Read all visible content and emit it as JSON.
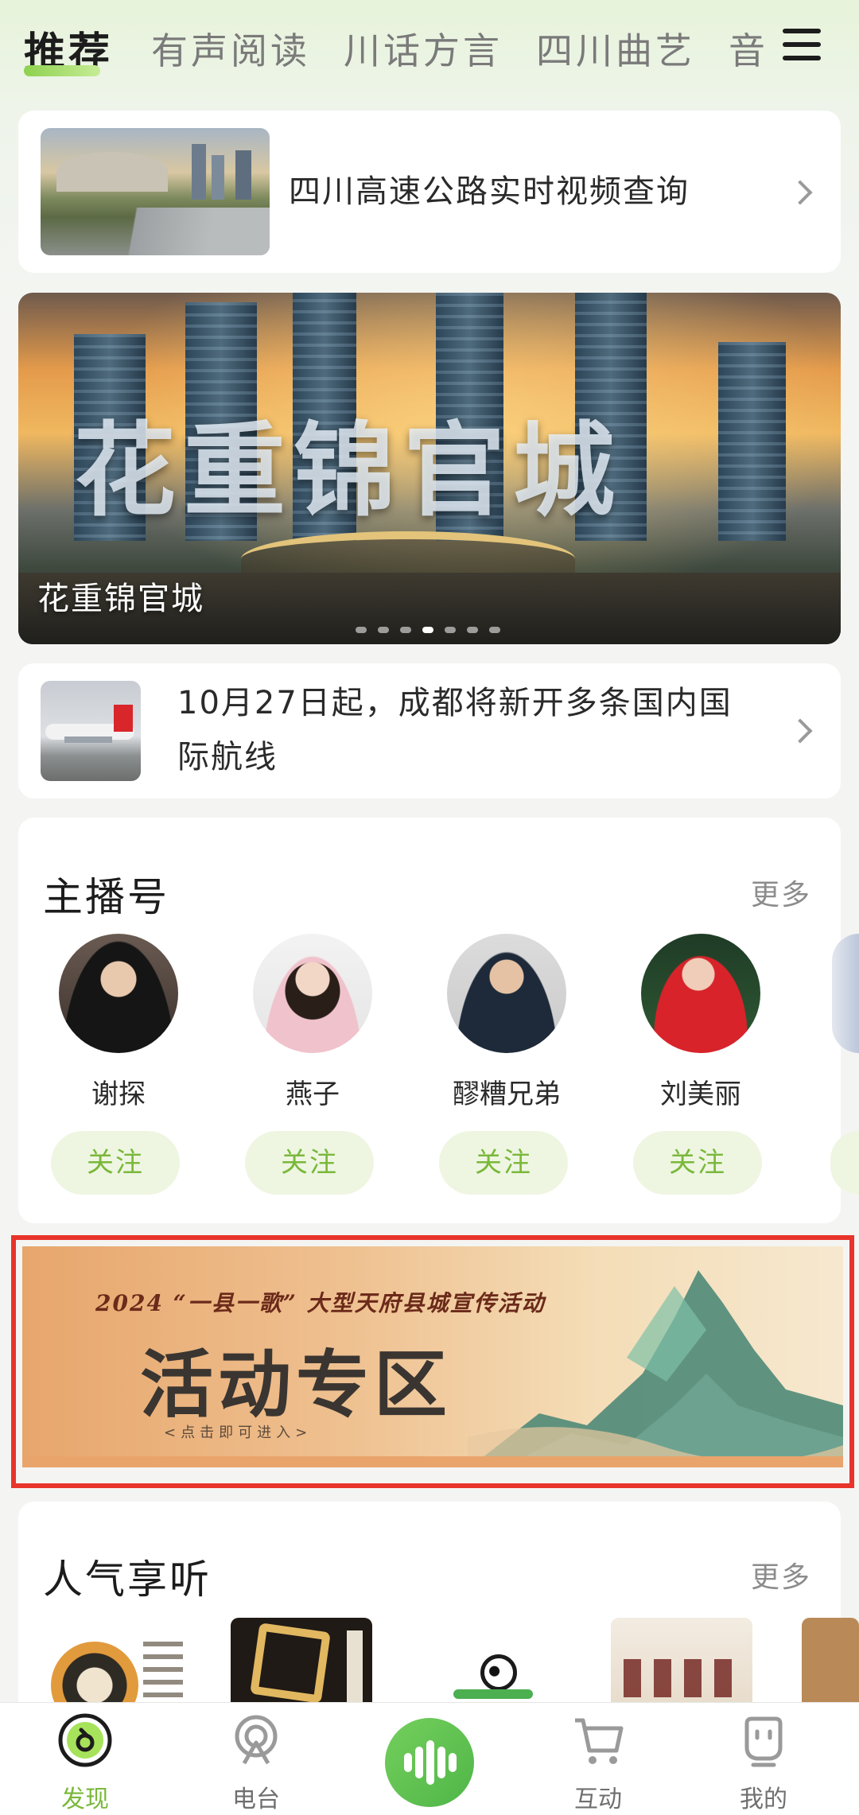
{
  "top_tabs": [
    "推荐",
    "有声阅读",
    "川话方言",
    "四川曲艺",
    "音"
  ],
  "news": [
    {
      "title": "四川高速公路实时视频查询"
    },
    {
      "title_line1": "10月27日起，成都将新开多条国内国",
      "title_line2": "际航线"
    }
  ],
  "banner": {
    "big_text": "花重锦官城",
    "caption": "花重锦官城"
  },
  "anchors_section": {
    "title": "主播号",
    "more": "更多",
    "anchors": [
      {
        "name": "谢探",
        "follow": "关注"
      },
      {
        "name": "燕子",
        "follow": "关注"
      },
      {
        "name": "醪糟兄弟",
        "follow": "关注"
      },
      {
        "name": "刘美丽",
        "follow": "关注"
      }
    ]
  },
  "promo": {
    "subtitle": "2024 “一县一歌” 大型天府县城宣传活动",
    "title": "活动专区",
    "hint": "<点击即可进入>"
  },
  "popular_section": {
    "title": "人气享听",
    "more": "更多"
  },
  "bottom_nav": [
    {
      "label": "发现",
      "icon": "discover-icon"
    },
    {
      "label": "电台",
      "icon": "radio-icon"
    },
    {
      "label": "",
      "icon": "audio-wave-icon"
    },
    {
      "label": "互动",
      "icon": "cart-icon"
    },
    {
      "label": "我的",
      "icon": "profile-icon"
    }
  ],
  "colors": {
    "accent_green": "#7ab83a",
    "follow_bg": "#eef6e2",
    "highlight_border": "#e8342a"
  }
}
